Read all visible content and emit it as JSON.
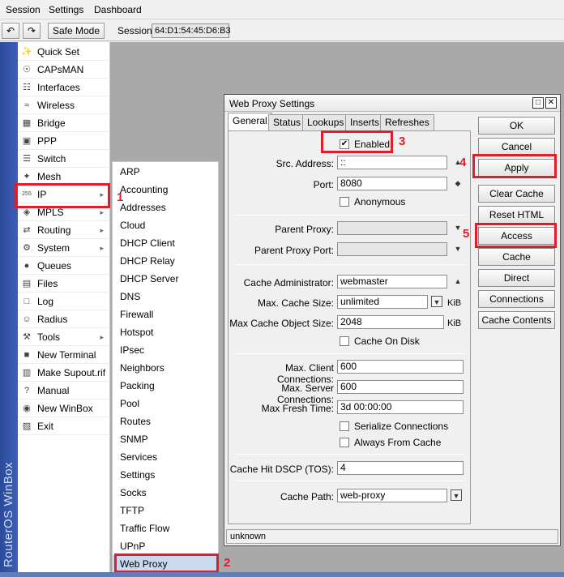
{
  "menubar": {
    "items": [
      "Session",
      "Settings",
      "Dashboard"
    ]
  },
  "toolbar": {
    "undo_icon": "undo-icon",
    "redo_icon": "redo-icon",
    "safe_mode_label": "Safe Mode",
    "session_label": "Session:",
    "session_value": "64:D1:54:45:D6:B3"
  },
  "brand_text": "RouterOS WinBox",
  "left_menu": {
    "items": [
      {
        "label": "Quick Set",
        "icon": "wand-icon",
        "arrow": false
      },
      {
        "label": "CAPsMAN",
        "icon": "antenna-icon",
        "arrow": false
      },
      {
        "label": "Interfaces",
        "icon": "interfaces-icon",
        "arrow": false
      },
      {
        "label": "Wireless",
        "icon": "wireless-icon",
        "arrow": false
      },
      {
        "label": "Bridge",
        "icon": "bridge-icon",
        "arrow": false
      },
      {
        "label": "PPP",
        "icon": "ppp-icon",
        "arrow": false
      },
      {
        "label": "Switch",
        "icon": "switch-icon",
        "arrow": false
      },
      {
        "label": "Mesh",
        "icon": "mesh-icon",
        "arrow": false
      },
      {
        "label": "IP",
        "icon": "ip-icon",
        "arrow": true
      },
      {
        "label": "MPLS",
        "icon": "mpls-icon",
        "arrow": true
      },
      {
        "label": "Routing",
        "icon": "routing-icon",
        "arrow": true
      },
      {
        "label": "System",
        "icon": "gear-icon",
        "arrow": true
      },
      {
        "label": "Queues",
        "icon": "queues-icon",
        "arrow": false
      },
      {
        "label": "Files",
        "icon": "folder-icon",
        "arrow": false
      },
      {
        "label": "Log",
        "icon": "log-icon",
        "arrow": false
      },
      {
        "label": "Radius",
        "icon": "radius-icon",
        "arrow": false
      },
      {
        "label": "Tools",
        "icon": "tools-icon",
        "arrow": true
      },
      {
        "label": "New Terminal",
        "icon": "terminal-icon",
        "arrow": false
      },
      {
        "label": "Make Supout.rif",
        "icon": "supout-icon",
        "arrow": false
      },
      {
        "label": "Manual",
        "icon": "help-icon",
        "arrow": false
      },
      {
        "label": "New WinBox",
        "icon": "winbox-icon",
        "arrow": false
      },
      {
        "label": "Exit",
        "icon": "exit-icon",
        "arrow": false
      }
    ]
  },
  "submenu": {
    "items": [
      "ARP",
      "Accounting",
      "Addresses",
      "Cloud",
      "DHCP Client",
      "DHCP Relay",
      "DHCP Server",
      "DNS",
      "Firewall",
      "Hotspot",
      "IPsec",
      "Neighbors",
      "Packing",
      "Pool",
      "Routes",
      "SNMP",
      "Services",
      "Settings",
      "Socks",
      "TFTP",
      "Traffic Flow",
      "UPnP",
      "Web Proxy"
    ]
  },
  "dialog": {
    "title": "Web Proxy Settings",
    "tabs": [
      "General",
      "Status",
      "Lookups",
      "Inserts",
      "Refreshes"
    ],
    "enabled_label": "Enabled",
    "enabled_checked": true,
    "src_address_label": "Src. Address:",
    "src_address_value": "::",
    "port_label": "Port:",
    "port_value": "8080",
    "anonymous_label": "Anonymous",
    "parent_proxy_label": "Parent Proxy:",
    "parent_proxy_port_label": "Parent Proxy Port:",
    "cache_admin_label": "Cache Administrator:",
    "cache_admin_value": "webmaster",
    "max_cache_size_label": "Max. Cache Size:",
    "max_cache_size_value": "unlimited",
    "kib_unit": "KiB",
    "max_cache_obj_label": "Max Cache Object Size:",
    "max_cache_obj_value": "2048",
    "cache_on_disk_label": "Cache On Disk",
    "max_client_conn_label": "Max. Client Connections:",
    "max_client_conn_value": "600",
    "max_server_conn_label": "Max. Server Connections:",
    "max_server_conn_value": "600",
    "max_fresh_time_label": "Max Fresh Time:",
    "max_fresh_time_value": "3d 00:00:00",
    "serialize_label": "Serialize Connections",
    "always_cache_label": "Always From Cache",
    "cache_hit_label": "Cache Hit DSCP (TOS):",
    "cache_hit_value": "4",
    "cache_path_label": "Cache Path:",
    "cache_path_value": "web-proxy",
    "buttons": [
      "OK",
      "Cancel",
      "Apply",
      "Clear Cache",
      "Reset HTML",
      "Access",
      "Cache",
      "Direct",
      "Connections",
      "Cache Contents"
    ],
    "status": "unknown"
  },
  "annotations": [
    "1",
    "2",
    "3",
    "4",
    "5"
  ],
  "colors": {
    "highlight": "#e11d2b",
    "brand": "#2c4a9a",
    "selection": "#c9d9f0"
  }
}
